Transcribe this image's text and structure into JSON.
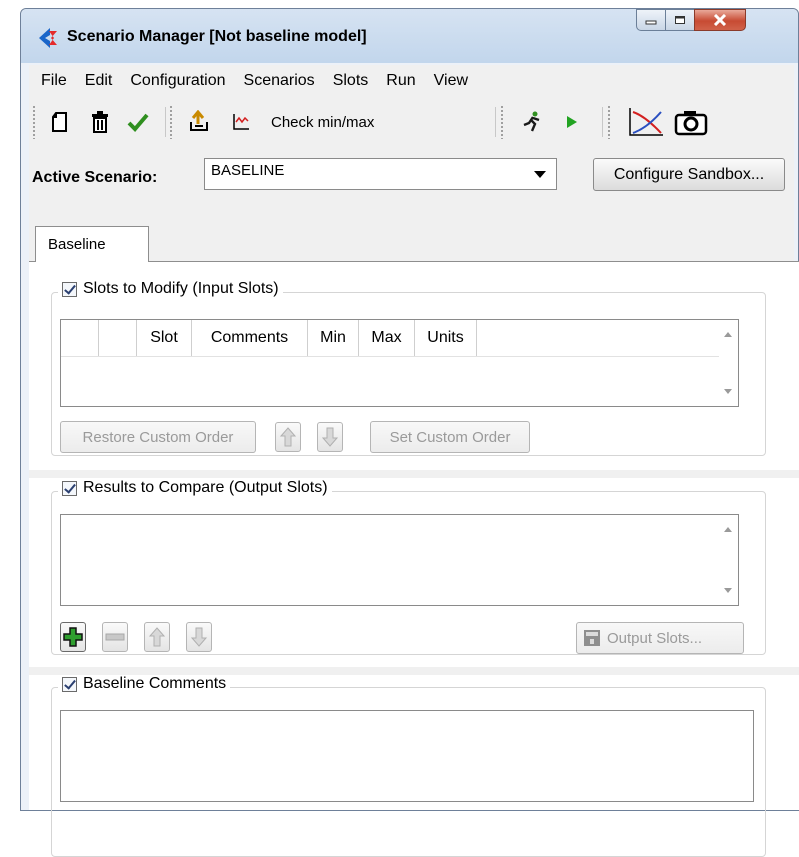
{
  "window": {
    "title": "Scenario Manager [Not baseline model]",
    "accent": "#1b66c9"
  },
  "menu": [
    "File",
    "Edit",
    "Configuration",
    "Scenarios",
    "Slots",
    "Run",
    "View"
  ],
  "toolbar": {
    "new_icon": "new-document-icon",
    "delete_icon": "trash-icon",
    "validate_icon": "checkmark-icon",
    "export_icon": "export-icon",
    "minmax_icon": "chart-icon",
    "check_minmax_label": "Check min/max",
    "run_icon": "runner-icon",
    "play_icon": "play-icon",
    "plot_icon": "plot-icon",
    "snapshot_icon": "camera-icon"
  },
  "active_scenario": {
    "label": "Active Scenario:",
    "value": "BASELINE",
    "configure_label": "Configure Sandbox..."
  },
  "tabs": [
    {
      "label": "Baseline"
    }
  ],
  "slots_to_modify": {
    "legend": "Slots to Modify (Input Slots)",
    "checked": true,
    "columns": [
      "",
      "",
      "Slot",
      "Comments",
      "Min",
      "Max",
      "Units"
    ],
    "rows": [],
    "restore_label": "Restore Custom Order",
    "set_label": "Set Custom Order"
  },
  "results_to_compare": {
    "legend": "Results to Compare (Output Slots)",
    "checked": true,
    "rows": [],
    "output_slots_label": "Output Slots..."
  },
  "baseline_comments": {
    "legend": "Baseline Comments",
    "checked": true,
    "text": ""
  }
}
